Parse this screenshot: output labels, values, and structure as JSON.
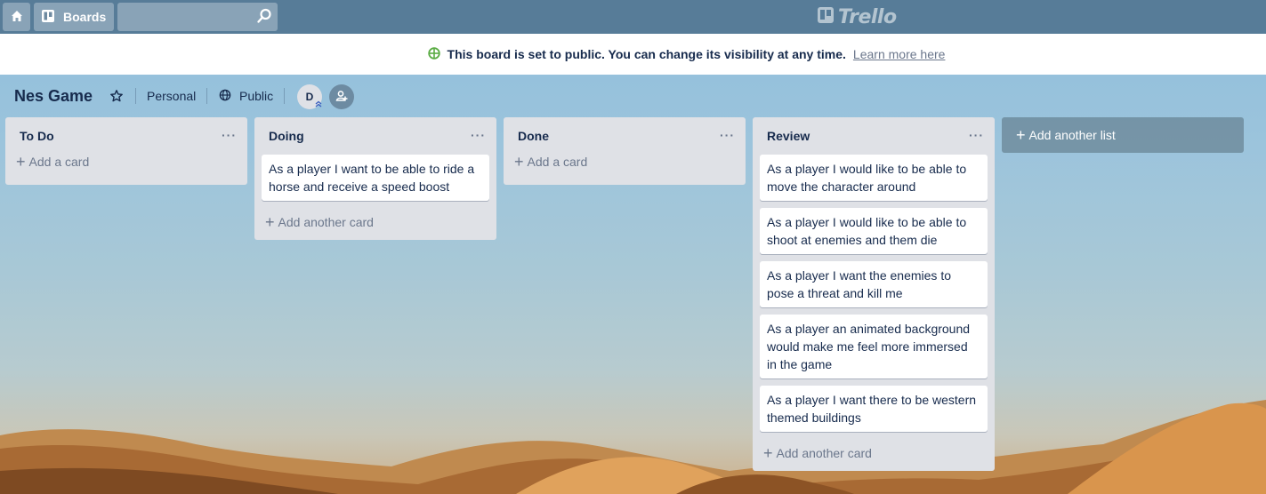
{
  "topbar": {
    "boards_label": "Boards",
    "search_value": "",
    "logo_text": "Trello"
  },
  "banner": {
    "message": "This board is set to public. You can change its visibility at any time.",
    "link_text": "Learn more here",
    "icon": "globe-icon",
    "icon_color": "#5aac44"
  },
  "board": {
    "title": "Nes Game",
    "team": "Personal",
    "visibility": "Public",
    "member_initial": "D"
  },
  "lists": [
    {
      "title": "To Do",
      "menu": "···",
      "cards": [],
      "add_label": "Add a card"
    },
    {
      "title": "Doing",
      "menu": "···",
      "cards": [
        "As a player I want to be able to ride a horse and receive a speed boost"
      ],
      "add_label": "Add another card"
    },
    {
      "title": "Done",
      "menu": "···",
      "cards": [],
      "add_label": "Add a card"
    },
    {
      "title": "Review",
      "menu": "···",
      "cards": [
        "As a player I would like to be able to move the character around",
        "As a player I would like to be able to shoot at enemies and them die",
        "As a player I want the enemies to pose a threat and kill me",
        "As a player an animated background would make me feel more immersed in the game",
        "As a player I want there to be western themed buildings"
      ],
      "add_label": "Add another card"
    }
  ],
  "add_list_label": "Add another list",
  "colors": {
    "topbar": "#577c98",
    "list_bg": "#dfe1e6",
    "text": "#172b4d",
    "muted": "#6b778c"
  }
}
